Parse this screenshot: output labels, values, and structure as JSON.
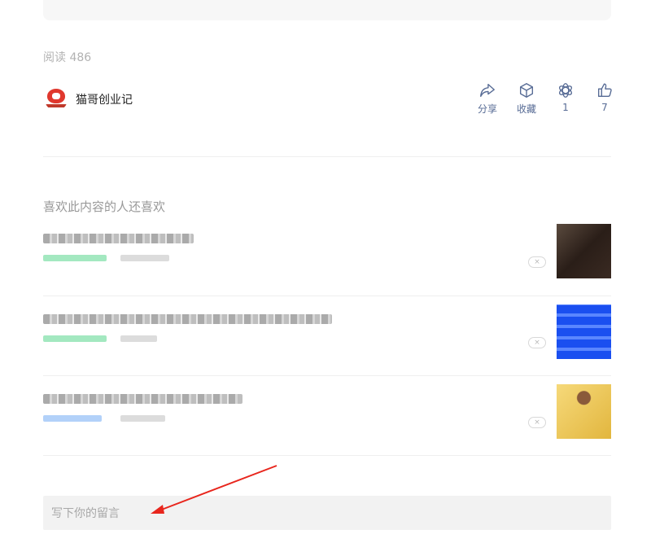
{
  "read_count": "阅读 486",
  "author": {
    "name": "猫哥创业记",
    "avatar_icon": "red-cat-logo-icon"
  },
  "actions": [
    {
      "icon": "share-icon",
      "label": "分享"
    },
    {
      "icon": "favorite-cube-icon",
      "label": "收藏"
    },
    {
      "icon": "wow-flower-icon",
      "label": "1"
    },
    {
      "icon": "thumbs-up-icon",
      "label": "7"
    }
  ],
  "related": {
    "title": "喜欢此内容的人还喜欢",
    "items": [
      {
        "dismiss": "×",
        "tag_color": "#58d68d",
        "thumb_style": "dark"
      },
      {
        "dismiss": "×",
        "tag_color": "#58d68d",
        "thumb_style": "blue"
      },
      {
        "dismiss": "×",
        "tag_color": "#7fb3f5",
        "thumb_style": "yellow"
      }
    ]
  },
  "comment": {
    "placeholder": "写下你的留言"
  },
  "colors": {
    "link": "#576b95",
    "annotation_arrow": "#e8261d"
  }
}
